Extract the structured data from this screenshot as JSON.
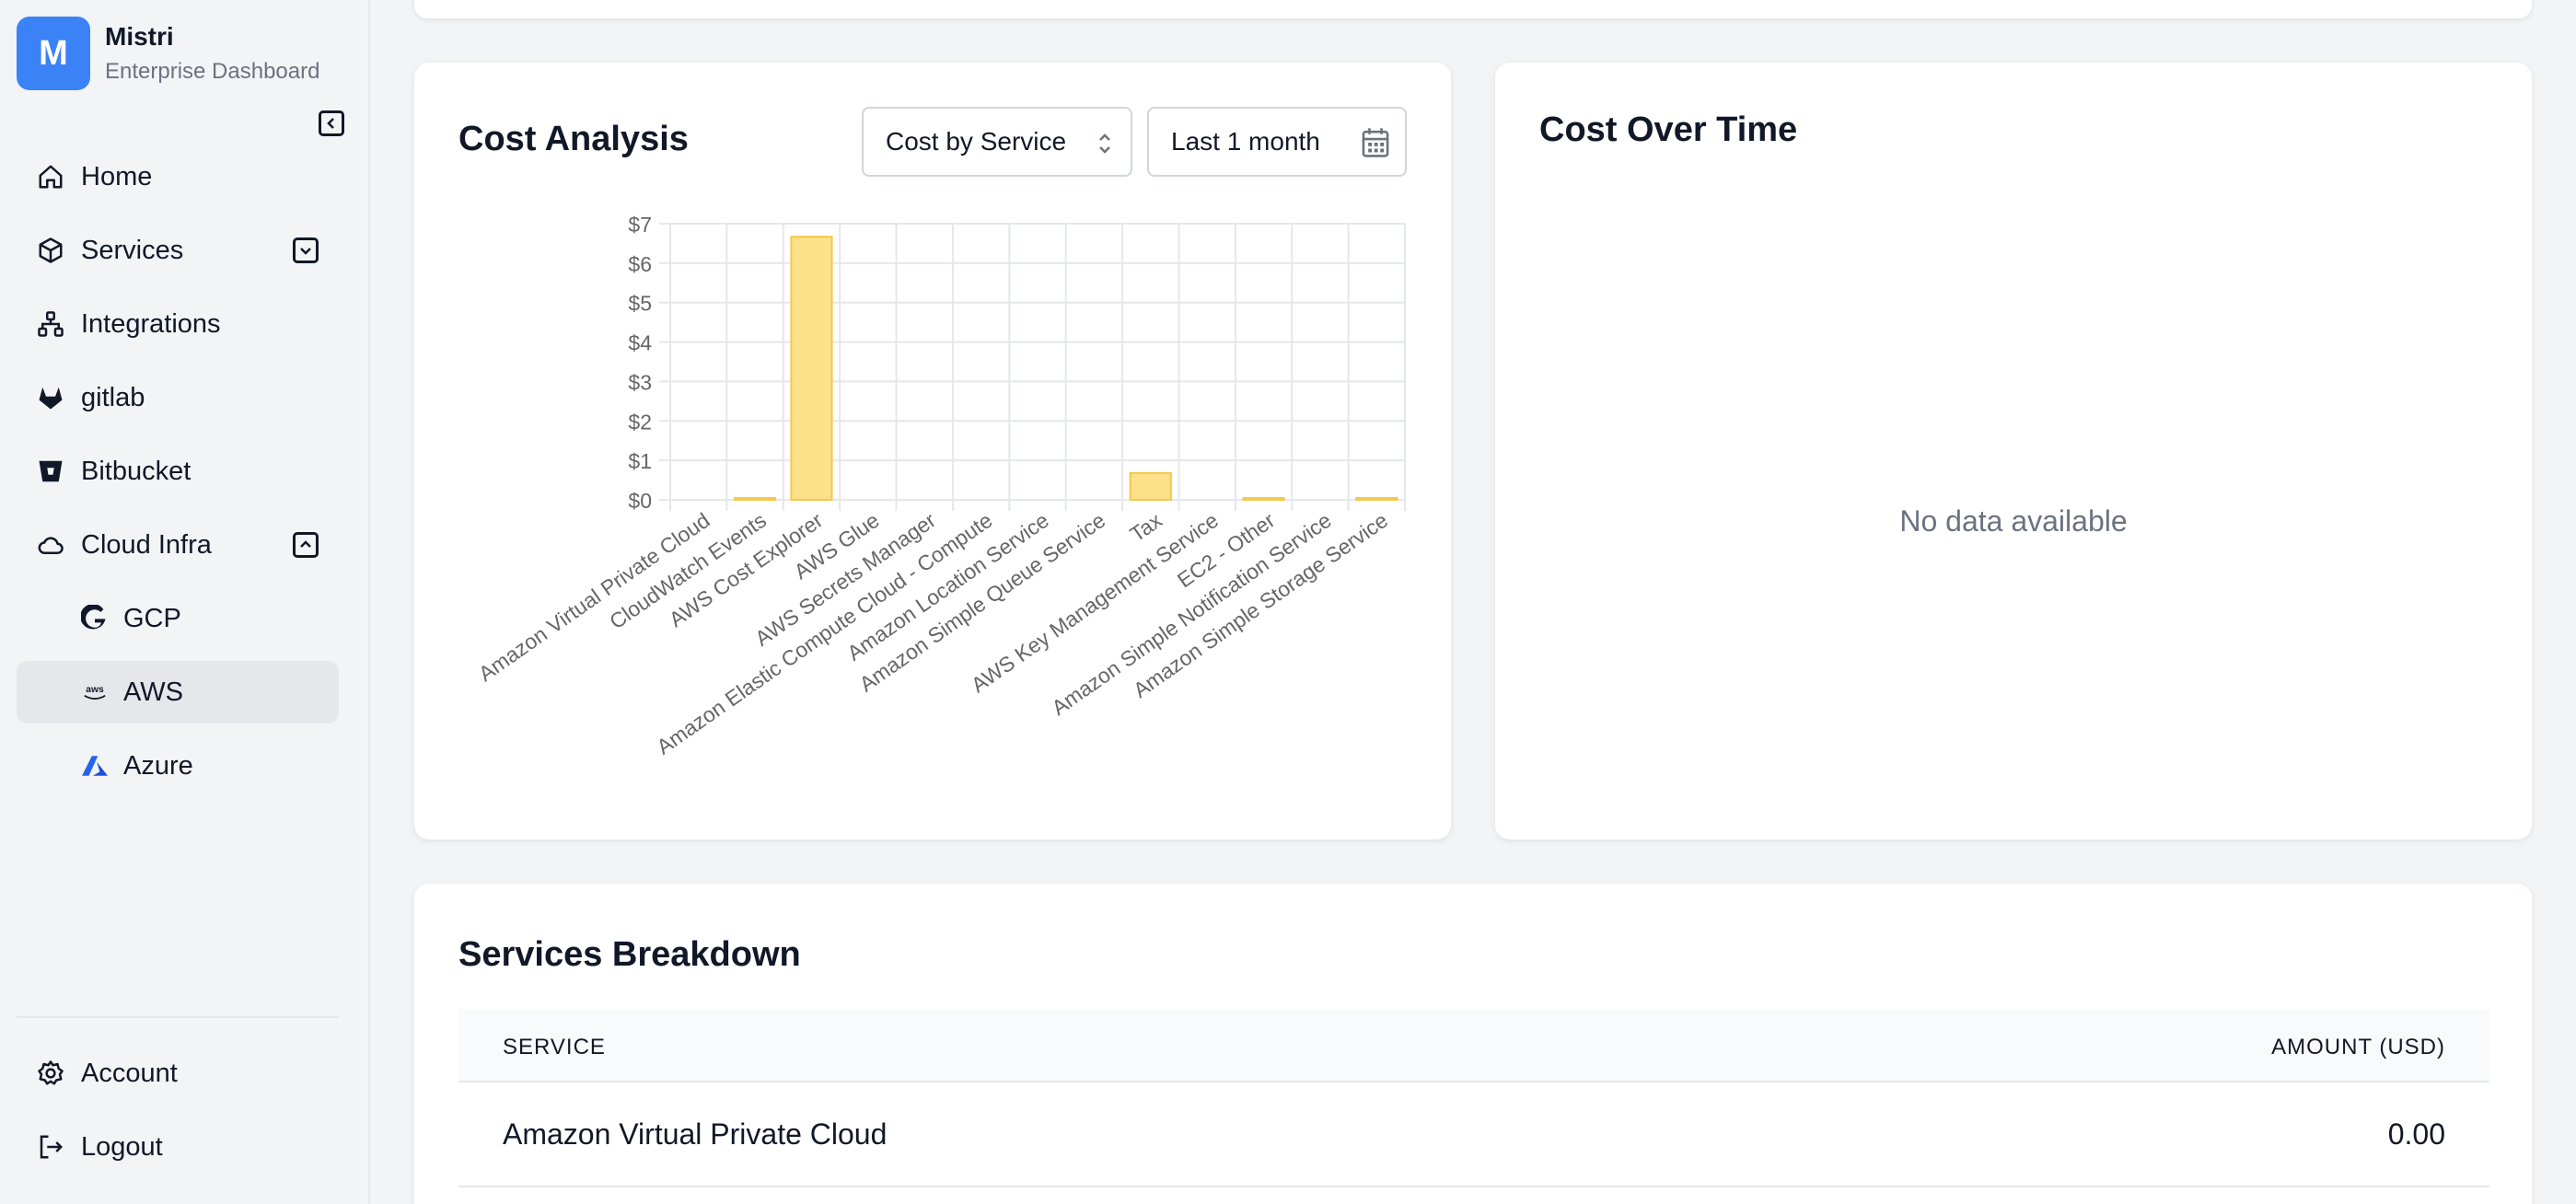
{
  "brand": {
    "initial": "M",
    "name": "Mistri",
    "subtitle": "Enterprise Dashboard"
  },
  "sidebar": {
    "items": [
      {
        "label": "Home",
        "icon": "home-icon"
      },
      {
        "label": "Services",
        "icon": "cube-icon"
      },
      {
        "label": "Integrations",
        "icon": "network-icon"
      },
      {
        "label": "gitlab",
        "icon": "gitlab-icon"
      },
      {
        "label": "Bitbucket",
        "icon": "bitbucket-icon"
      },
      {
        "label": "Cloud Infra",
        "icon": "cloud-icon"
      },
      {
        "label": "GCP",
        "icon": "gcp-icon"
      },
      {
        "label": "AWS",
        "icon": "aws-icon"
      },
      {
        "label": "Azure",
        "icon": "azure-icon"
      }
    ],
    "bottom": [
      {
        "label": "Account",
        "icon": "gear-icon"
      },
      {
        "label": "Logout",
        "icon": "logout-icon"
      }
    ]
  },
  "cost_analysis": {
    "title": "Cost Analysis",
    "group_by": "Cost by Service",
    "range": "Last 1 month"
  },
  "cost_over_time": {
    "title": "Cost Over Time",
    "empty": "No data available"
  },
  "breakdown": {
    "title": "Services Breakdown",
    "col_service": "SERVICE",
    "col_amount": "AMOUNT (USD)",
    "rows": [
      {
        "service": "Amazon Virtual Private Cloud",
        "amount": "0.00"
      }
    ]
  },
  "chart_data": {
    "type": "bar",
    "categories": [
      "Amazon Virtual Private Cloud",
      "CloudWatch Events",
      "AWS Cost Explorer",
      "AWS Glue",
      "AWS Secrets Manager",
      "Amazon Elastic Compute Cloud - Compute",
      "Amazon Location Service",
      "Amazon Simple Queue Service",
      "Tax",
      "AWS Key Management Service",
      "EC2 - Other",
      "Amazon Simple Notification Service",
      "Amazon Simple Storage Service"
    ],
    "values": [
      0,
      0.01,
      6.67,
      0,
      0,
      0,
      0,
      0,
      0.68,
      0,
      0.01,
      0,
      0.01
    ],
    "y_ticks": [
      "$0",
      "$1",
      "$2",
      "$3",
      "$4",
      "$5",
      "$6",
      "$7"
    ],
    "ylim": [
      0,
      7
    ],
    "grid": true,
    "bar_color": "#fde08a",
    "bar_border": "#f2c94c",
    "title": "",
    "xlabel": "",
    "ylabel": ""
  }
}
